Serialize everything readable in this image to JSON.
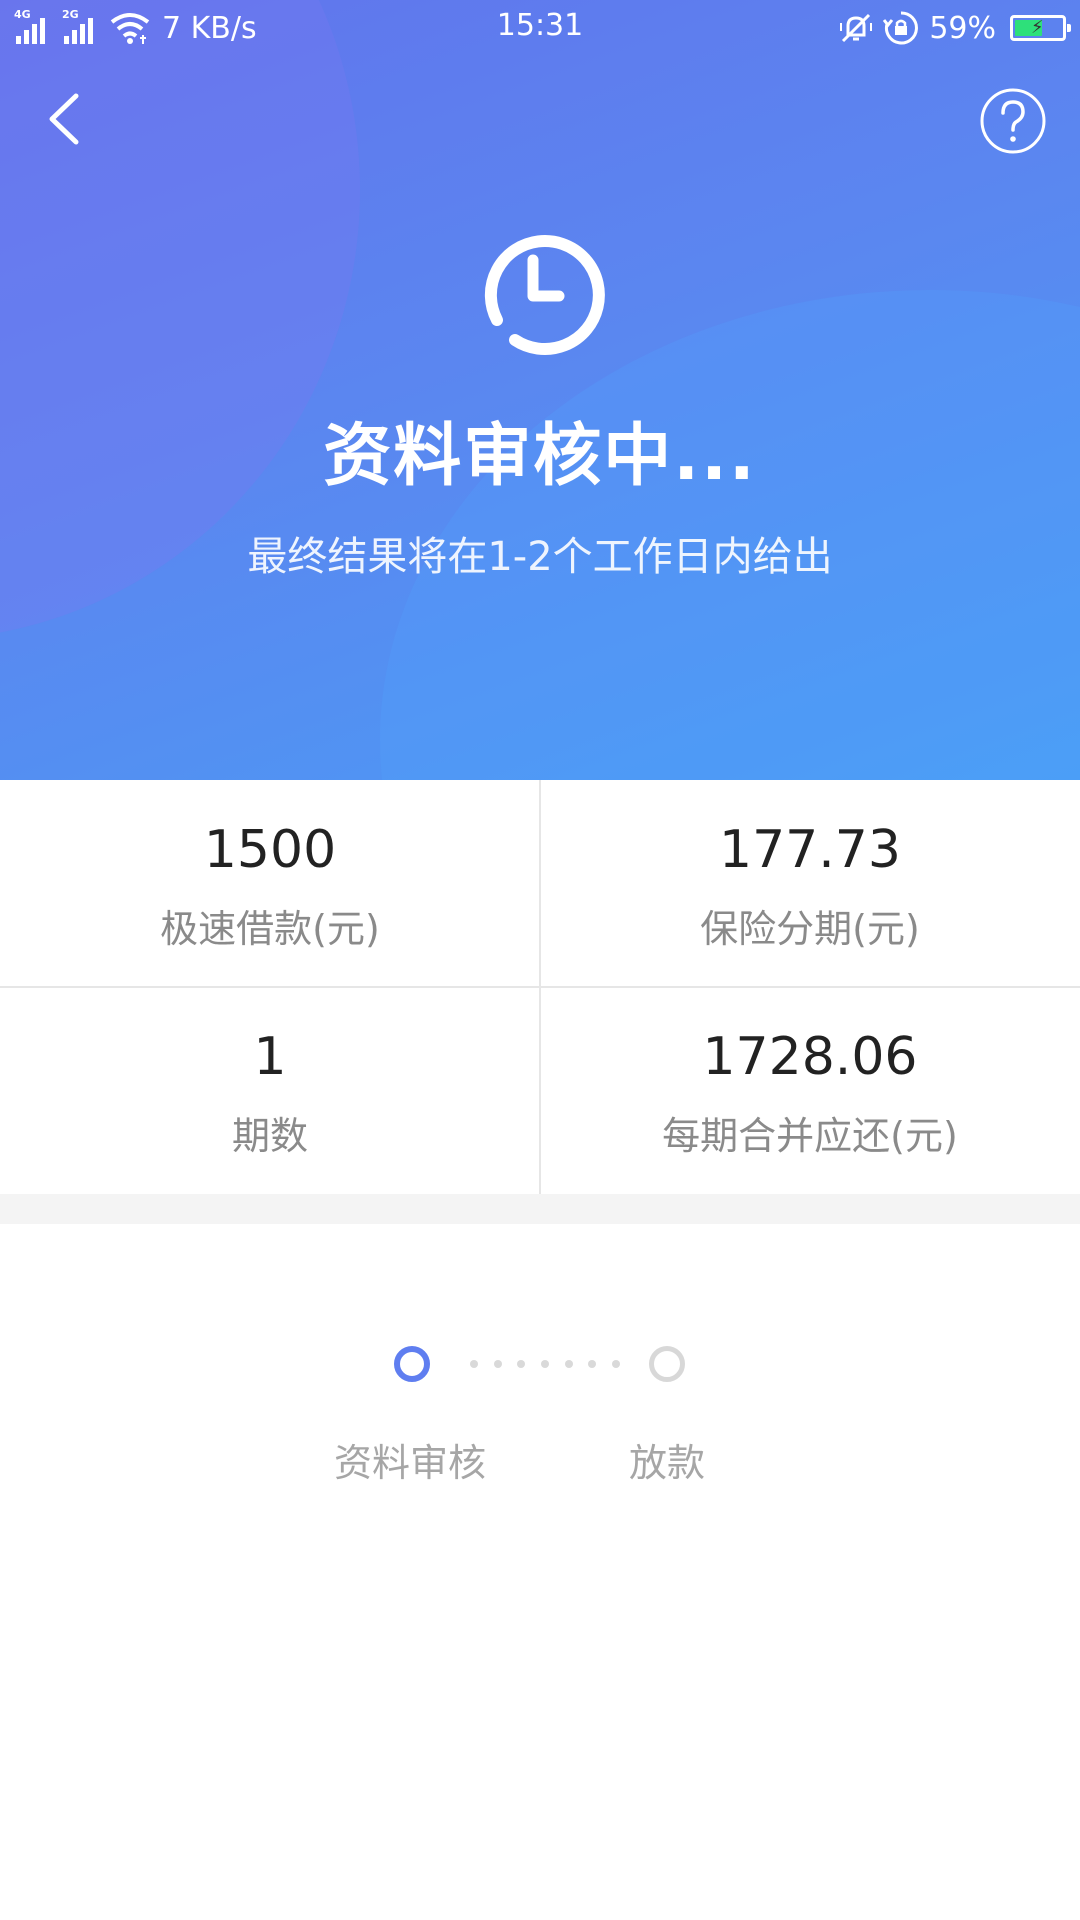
{
  "status_bar": {
    "network_1": "4G",
    "network_2": "2G",
    "speed": "7 KB/s",
    "time": "15:31",
    "battery": "59%",
    "battery_level": 0.59
  },
  "nav": {
    "back_icon": "chevron-left-icon",
    "help_icon": "question-circle-icon"
  },
  "hero": {
    "icon": "clock-icon",
    "title": "资料审核中...",
    "subtitle": "最终结果将在1-2个工作日内给出"
  },
  "summary": {
    "loan_amount": {
      "value": "1500",
      "label": "极速借款(元)"
    },
    "insurance": {
      "value": "177.73",
      "label": "保险分期(元)"
    },
    "periods": {
      "value": "1",
      "label": "期数"
    },
    "per_period": {
      "value": "1728.06",
      "label": "每期合并应还(元)"
    }
  },
  "steps": [
    {
      "label": "资料审核",
      "state": "active"
    },
    {
      "label": "放款",
      "state": "pending"
    }
  ],
  "colors": {
    "accent": "#5f7ef0",
    "hero_start": "#6174ec",
    "hero_end": "#4a9cf5",
    "value_text": "#222222",
    "label_text": "#8a8a8a"
  }
}
